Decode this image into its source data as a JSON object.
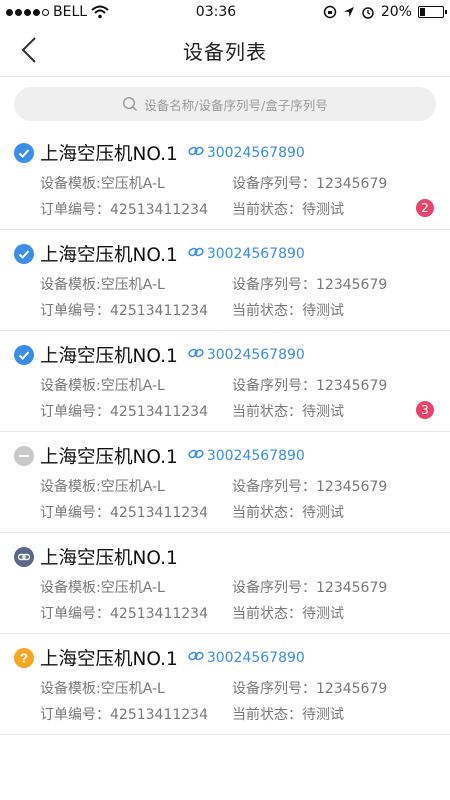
{
  "status_bar": {
    "carrier": "BELL",
    "time": "03:36",
    "battery": "20%",
    "battery_level": 0.2
  },
  "header": {
    "title": "设备列表"
  },
  "search": {
    "placeholder": "设备名称/设备序列号/盒子序列号"
  },
  "colors": {
    "accent": "#3a8ee6",
    "badge": "#e8456b",
    "ok": "#3a8ee6",
    "disabled": "#c8c8c8",
    "offline": "#5b6787",
    "warning": "#f5a623"
  },
  "devices": [
    {
      "name": "上海空压机NO.1",
      "link_id": "30024567890",
      "status_icon": "check-circle-icon",
      "template": "设备模板:空压机A-L",
      "serial": "设备序列号：12345679",
      "order": "订单编号：42513411234",
      "state": "当前状态：待测试",
      "badge": "2"
    },
    {
      "name": "上海空压机NO.1",
      "link_id": "30024567890",
      "status_icon": "check-circle-icon",
      "template": "设备模板:空压机A-L",
      "serial": "设备序列号：12345679",
      "order": "订单编号：42513411234",
      "state": "当前状态：待测试",
      "badge": ""
    },
    {
      "name": "上海空压机NO.1",
      "link_id": "30024567890",
      "status_icon": "check-circle-icon",
      "template": "设备模板:空压机A-L",
      "serial": "设备序列号：12345679",
      "order": "订单编号：42513411234",
      "state": "当前状态：待测试",
      "badge": "3"
    },
    {
      "name": "上海空压机NO.1",
      "link_id": "30024567890",
      "status_icon": "minus-circle-icon",
      "template": "设备模板:空压机A-L",
      "serial": "设备序列号：12345679",
      "order": "订单编号：42513411234",
      "state": "当前状态：待测试",
      "badge": ""
    },
    {
      "name": "上海空压机NO.1",
      "link_id": "",
      "status_icon": "unlink-circle-icon",
      "template": "设备模板:空压机A-L",
      "serial": "设备序列号：12345679",
      "order": "订单编号：42513411234",
      "state": "当前状态：待测试",
      "badge": ""
    },
    {
      "name": "上海空压机NO.1",
      "link_id": "30024567890",
      "status_icon": "question-circle-icon",
      "template": "设备模板:空压机A-L",
      "serial": "设备序列号：12345679",
      "order": "订单编号：42513411234",
      "state": "当前状态：待测试",
      "badge": ""
    }
  ]
}
